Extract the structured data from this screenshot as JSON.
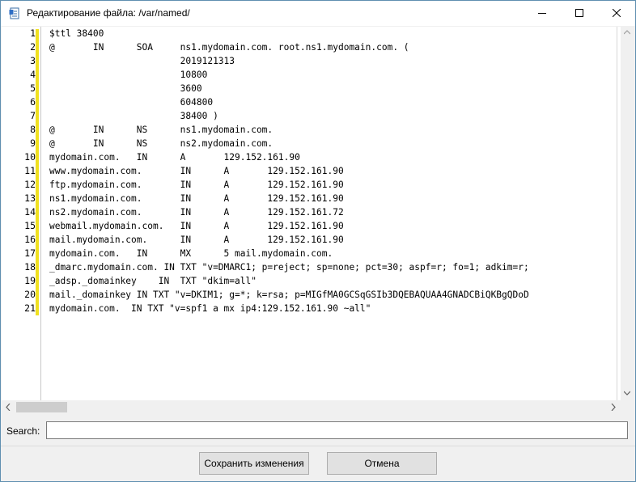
{
  "window": {
    "title": "Редактирование файла: /var/named/",
    "icon": "document-edit-icon"
  },
  "editor": {
    "line_numbers": [
      "1",
      "2",
      "3",
      "4",
      "5",
      "6",
      "7",
      "8",
      "9",
      "10",
      "11",
      "12",
      "13",
      "14",
      "15",
      "16",
      "17",
      "18",
      "19",
      "20",
      "21"
    ],
    "lines": [
      "$ttl 38400",
      "@       IN      SOA     ns1.mydomain.com. root.ns1.mydomain.com. (",
      "                        2019121313",
      "                        10800",
      "                        3600",
      "                        604800",
      "                        38400 )",
      "@       IN      NS      ns1.mydomain.com.",
      "@       IN      NS      ns2.mydomain.com.",
      "mydomain.com.   IN      A       129.152.161.90",
      "www.mydomain.com.       IN      A       129.152.161.90",
      "ftp.mydomain.com.       IN      A       129.152.161.90",
      "ns1.mydomain.com.       IN      A       129.152.161.90",
      "ns2.mydomain.com.       IN      A       129.152.161.72",
      "webmail.mydomain.com.   IN      A       129.152.161.90",
      "mail.mydomain.com.      IN      A       129.152.161.90",
      "mydomain.com.   IN      MX      5 mail.mydomain.com.",
      "_dmarc.mydomain.com. IN TXT \"v=DMARC1; p=reject; sp=none; pct=30; aspf=r; fo=1; adkim=r;",
      "_adsp._domainkey    IN  TXT \"dkim=all\"",
      "mail._domainkey IN TXT \"v=DKIM1; g=*; k=rsa; p=MIGfMA0GCSqGSIb3DQEBAQUAA4GNADCBiQKBgQDoD",
      "mydomain.com.  IN TXT \"v=spf1 a mx ip4:129.152.161.90 ~all\""
    ],
    "marker_color": "#f0e020"
  },
  "search": {
    "label": "Search:",
    "value": ""
  },
  "buttons": {
    "save": "Сохранить изменения",
    "cancel": "Отмена"
  }
}
